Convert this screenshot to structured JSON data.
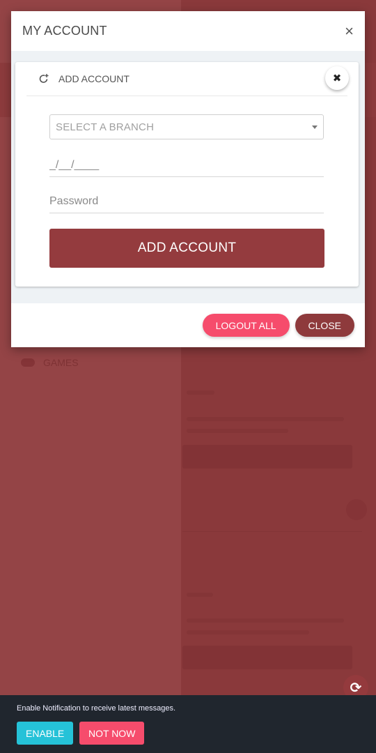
{
  "background": {
    "sidebar_item": "GAMES"
  },
  "modal": {
    "title": "MY ACCOUNT",
    "close_icon": "×",
    "card": {
      "title": "ADD ACCOUNT",
      "icon": "refresh-plus-icon",
      "close_icon": "✖",
      "branch_select": {
        "placeholder": "SELECT A BRANCH",
        "value": ""
      },
      "date_field": {
        "placeholder": "_/__/____",
        "value": ""
      },
      "password_field": {
        "placeholder": "Password",
        "value": ""
      },
      "submit_label": "ADD ACCOUNT"
    },
    "footer": {
      "logout_all_label": "LOGOUT ALL",
      "close_label": "CLOSE"
    }
  },
  "notification": {
    "message": "Enable Notification to receive latest messages.",
    "enable_label": "ENABLE",
    "not_now_label": "NOT NOW"
  },
  "refresh_fab": {
    "icon": "⟳"
  },
  "colors": {
    "primary": "#943b3e",
    "accent_pink": "#f64c6c",
    "accent_cyan": "#25c2d8",
    "notification_bg": "#20262e"
  }
}
